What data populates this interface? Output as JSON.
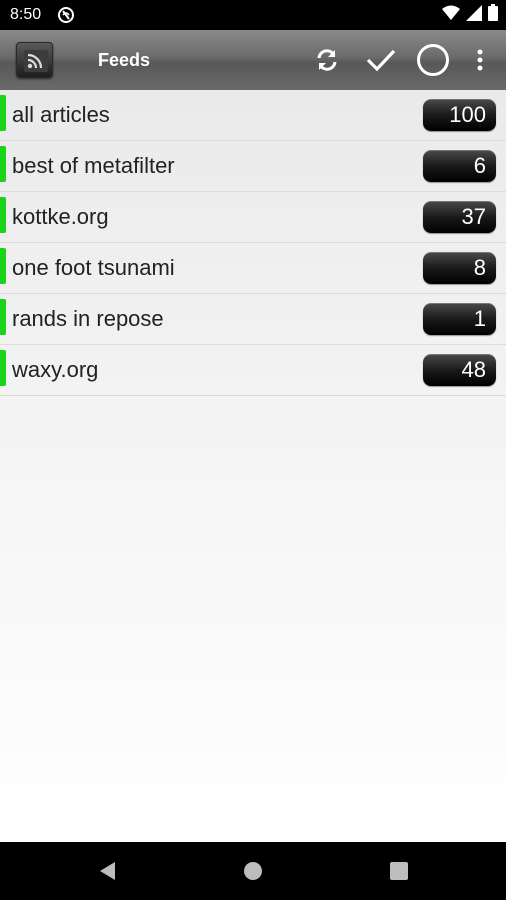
{
  "status": {
    "time": "8:50"
  },
  "action_bar": {
    "title": "Feeds"
  },
  "feeds": [
    {
      "name": "all articles",
      "count": "100"
    },
    {
      "name": "best of metafilter",
      "count": "6"
    },
    {
      "name": "kottke.org",
      "count": "37"
    },
    {
      "name": "one foot tsunami",
      "count": "8"
    },
    {
      "name": "rands in repose",
      "count": "1"
    },
    {
      "name": "waxy.org",
      "count": "48"
    }
  ],
  "icons": {
    "app": "rss-feed-icon",
    "refresh": "refresh-icon",
    "mark_read": "checkmark-icon",
    "circle": "circle-icon",
    "overflow": "more-vert-icon",
    "back": "nav-back-icon",
    "home": "nav-home-icon",
    "recents": "nav-recents-icon"
  },
  "colors": {
    "feed_indicator": "#19d419",
    "badge": "#000000",
    "action_bar": "#6b6b6b"
  }
}
